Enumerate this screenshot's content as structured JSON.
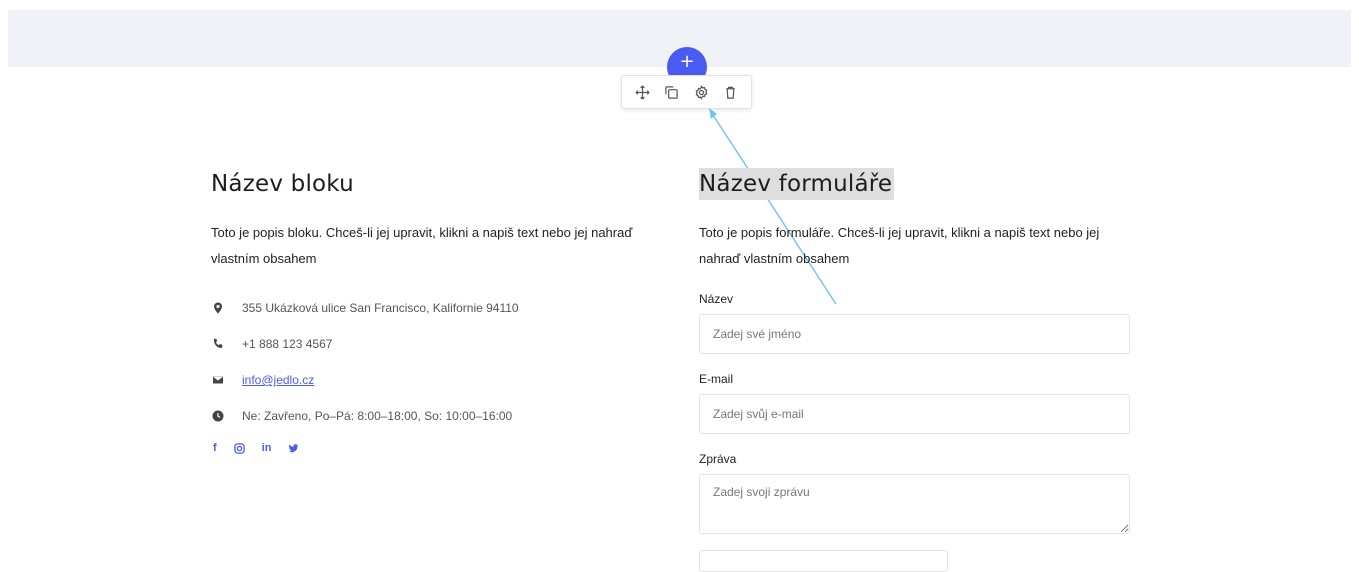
{
  "toolbar": {
    "add_symbol": "+",
    "icons": [
      "move-icon",
      "duplicate-icon",
      "settings-icon",
      "delete-icon"
    ]
  },
  "info_block": {
    "title": "Název bloku",
    "description": "Toto je popis bloku. Chceš-li jej upravit, klikni a napiš text nebo jej nahraď vlastním obsahem",
    "address": "355 Ukázková ulice San Francisco, Kalifornie 94110",
    "phone": "+1 888 123 4567",
    "email": "info@jedlo.cz",
    "hours": "Ne: Zavřeno, Po–Pá: 8:00–18:00, So: 10:00–16:00",
    "social": [
      "facebook-icon",
      "instagram-icon",
      "linkedin-icon",
      "twitter-icon"
    ],
    "social_labels": {
      "facebook": "f",
      "linkedin": "in"
    }
  },
  "form": {
    "title": "Název formuláře",
    "description": "Toto je popis formuláře. Chceš-li jej upravit, klikni a napiš text nebo jej nahraď vlastním obsahem",
    "name_label": "Název",
    "name_placeholder": "Zadej své jméno",
    "email_label": "E-mail",
    "email_placeholder": "Zadej svůj e-mail",
    "message_label": "Zpráva",
    "message_placeholder": "Zadej svoji zprávu"
  },
  "colors": {
    "accent": "#4a5cf0",
    "band": "#f1f2f7",
    "annotation_arrow": "#6cc3ee"
  }
}
